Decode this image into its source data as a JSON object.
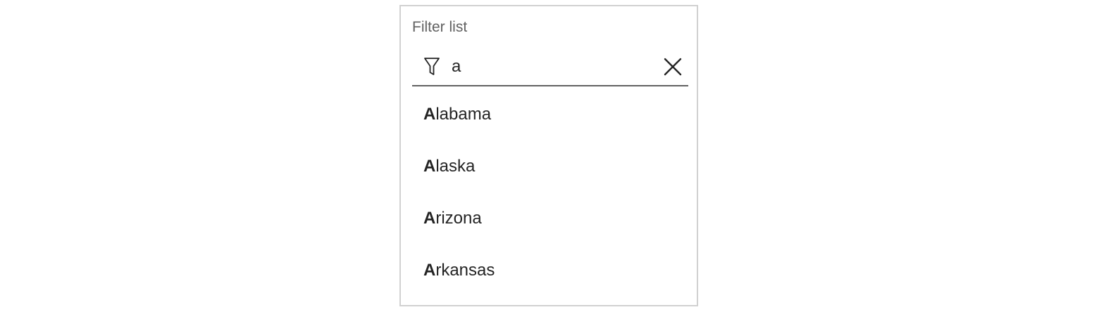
{
  "filter": {
    "label": "Filter list",
    "query": "a",
    "filter_icon": "filter-icon",
    "clear_icon": "close-icon"
  },
  "results": [
    {
      "match": "A",
      "rest": "labama"
    },
    {
      "match": "A",
      "rest": "laska"
    },
    {
      "match": "A",
      "rest": "rizona"
    },
    {
      "match": "A",
      "rest": "rkansas"
    }
  ],
  "colors": {
    "text": "#242424",
    "label": "#616161",
    "border": "#d1d1d1",
    "underline": "#616161"
  }
}
